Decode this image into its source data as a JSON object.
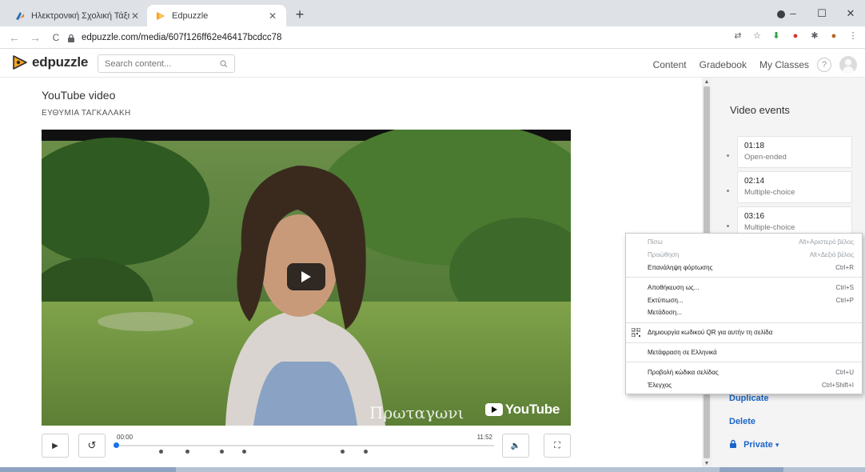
{
  "browser": {
    "tabs": [
      {
        "title": "Ηλεκτρονική Σχολική Τάξη (η-Τάξ",
        "active": false
      },
      {
        "title": "Edpuzzle",
        "active": true
      }
    ],
    "new_tab": "+",
    "window_controls": {
      "minimize": "–",
      "maximize": "☐",
      "close": "✕"
    },
    "url": "edpuzzle.com/media/607f126ff62e46417bcdcc78",
    "nav": {
      "back": "←",
      "forward": "→",
      "reload": "C"
    },
    "extension_icons": [
      "translate-icon",
      "star-icon",
      "download-arrow-icon",
      "extension-badge-icon",
      "puzzle-icon",
      "profile-avatar-icon",
      "menu-dots-icon"
    ],
    "menu_dots": "⋮"
  },
  "header": {
    "logo_text": "edpuzzle",
    "search_placeholder": "Search content...",
    "nav": [
      "Content",
      "Gradebook",
      "My Classes"
    ],
    "help": "?"
  },
  "video": {
    "title": "YouTube video",
    "author": "ΕΥΘΥΜΙΑ ΤΑΓΚΑΛΑΚΗ",
    "overlay_text": "Πρωταγωνι",
    "youtube_label": "YouTube",
    "time_start": "00:00",
    "time_end": "11:52",
    "progress_fraction": 0.0,
    "question_markers": [
      0.12,
      0.19,
      0.28,
      0.34,
      0.6,
      0.66
    ]
  },
  "controls": {
    "play": "▶",
    "rewind": "↺",
    "volume": "🔈",
    "fullscreen": "⛶"
  },
  "side_panel": {
    "title": "Video events",
    "events": [
      {
        "time": "01:18",
        "type": "Open-ended"
      },
      {
        "time": "02:14",
        "type": "Multiple-choice"
      },
      {
        "time": "03:16",
        "type": "Multiple-choice"
      }
    ],
    "actions": {
      "duplicate": "Duplicate",
      "delete": "Delete",
      "privacy": "Private"
    },
    "privacy_caret": "▾"
  },
  "context_menu": {
    "groups": [
      [
        {
          "label": "Πίσω",
          "shortcut": "Alt+Αριστερό βέλος",
          "disabled": true
        },
        {
          "label": "Προώθηση",
          "shortcut": "Alt+Δεξιό βέλος",
          "disabled": true
        },
        {
          "label": "Επανάληψη φόρτωσης",
          "shortcut": "Ctrl+R",
          "disabled": false
        }
      ],
      [
        {
          "label": "Αποθήκευση ως...",
          "shortcut": "Ctrl+S",
          "disabled": false
        },
        {
          "label": "Εκτύπωση...",
          "shortcut": "Ctrl+P",
          "disabled": false
        },
        {
          "label": "Μετάδοση...",
          "shortcut": "",
          "disabled": false
        }
      ],
      [
        {
          "label": "Δημιουργία κωδικού QR για αυτήν τη σελίδα",
          "shortcut": "",
          "disabled": false,
          "icon": "qr-code-icon"
        }
      ],
      [
        {
          "label": "Μετάφραση σε Ελληνικά",
          "shortcut": "",
          "disabled": false
        }
      ],
      [
        {
          "label": "Προβολή κώδικα σελίδας",
          "shortcut": "Ctrl+U",
          "disabled": false
        },
        {
          "label": "Έλεγχος",
          "shortcut": "Ctrl+Shift+I",
          "disabled": false
        }
      ]
    ]
  },
  "colors": {
    "accent_blue": "#1a66c9",
    "progress_blue": "#1a73e8",
    "logo_orange": "#f5a623",
    "tabstrip": "#dee1e6"
  }
}
